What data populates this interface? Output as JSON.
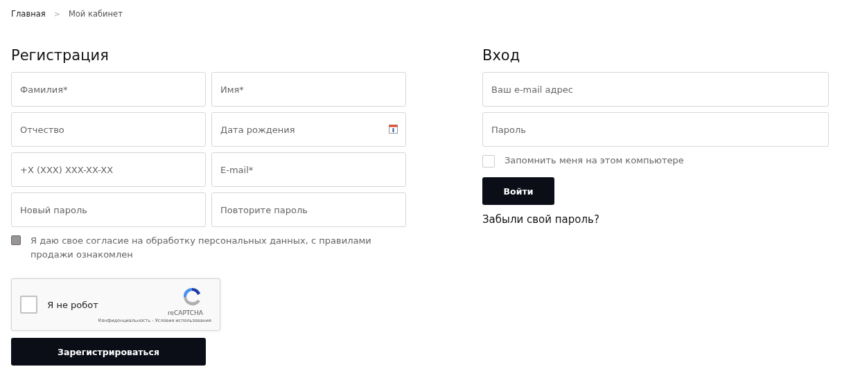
{
  "breadcrumbs": [
    {
      "label": "Главная"
    },
    {
      "label": "Мой кабинет"
    }
  ],
  "breadcrumb_separator": ">",
  "registration": {
    "title": "Регистрация",
    "fields": [
      {
        "placeholder": "Фамилия*",
        "kind": "text"
      },
      {
        "placeholder": "Имя*",
        "kind": "text"
      },
      {
        "placeholder": "Отчество",
        "kind": "text"
      },
      {
        "placeholder": "Дата рождения",
        "kind": "date"
      },
      {
        "placeholder": "+X (XXX) XXX-XX-XX",
        "kind": "text"
      },
      {
        "placeholder": "E-mail*",
        "kind": "text"
      },
      {
        "placeholder": "Новый пароль",
        "kind": "text"
      },
      {
        "placeholder": "Повторите пароль",
        "kind": "text"
      }
    ],
    "consent": {
      "label": "Я даю свое согласие на  обработку персональных данных, с правилами продажи ознакомлен",
      "checked": true
    },
    "captcha": {
      "label": "Я не робот",
      "checked": false,
      "brand": "reCAPTCHA",
      "links": "Конфиденциальность - Условия использования"
    },
    "submit": "Зарегистрироваться"
  },
  "login": {
    "title": "Вход",
    "fields": [
      {
        "placeholder": "Ваш e-mail адрес"
      },
      {
        "placeholder": "Пароль"
      }
    ],
    "remember": {
      "label": "Запомнить меня на этом компьютере",
      "checked": false
    },
    "submit": "Войти",
    "forgot": "Забыли свой пароль?"
  }
}
